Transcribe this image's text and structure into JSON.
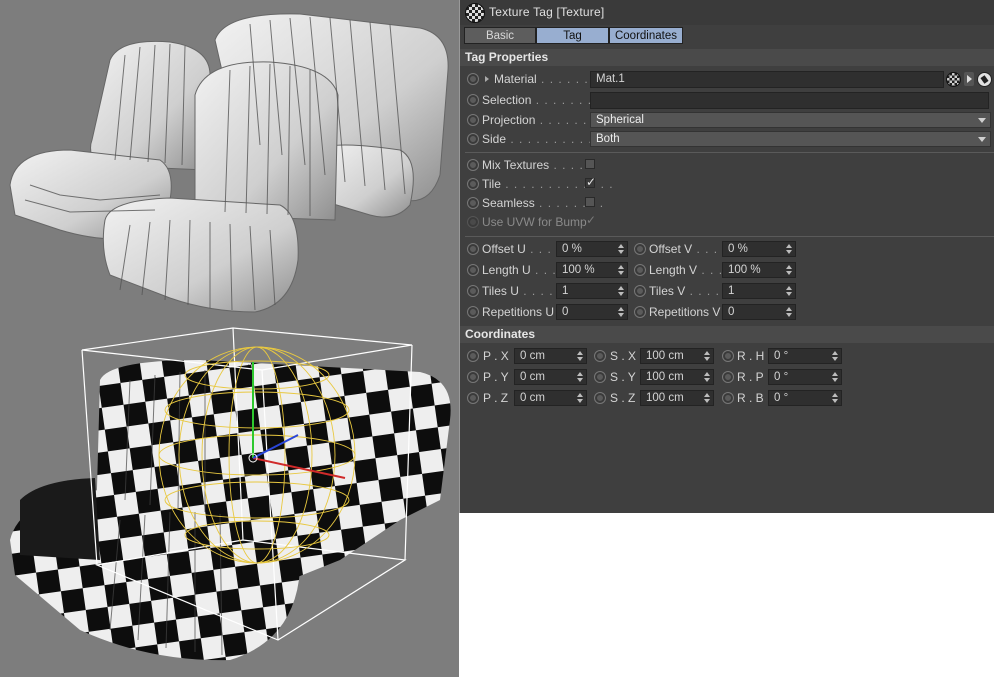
{
  "window": {
    "title": "Texture Tag [Texture]"
  },
  "tabs": [
    {
      "label": "Basic",
      "active": false
    },
    {
      "label": "Tag",
      "active": true
    },
    {
      "label": "Coordinates",
      "active": true
    }
  ],
  "tag_properties": {
    "heading": "Tag Properties",
    "material": {
      "label": "Material",
      "value": "Mat.1"
    },
    "selection": {
      "label": "Selection",
      "value": ""
    },
    "projection": {
      "label": "Projection",
      "value": "Spherical"
    },
    "side": {
      "label": "Side",
      "value": "Both"
    },
    "mix_textures": {
      "label": "Mix Textures",
      "checked": false
    },
    "tile": {
      "label": "Tile",
      "checked": true
    },
    "seamless": {
      "label": "Seamless",
      "checked": false
    },
    "use_uvw_for_bump": {
      "label": "Use UVW for Bump",
      "checked": true,
      "enabled": false
    },
    "offset_u": {
      "label": "Offset U",
      "value": "0 %"
    },
    "offset_v": {
      "label": "Offset V",
      "value": "0 %"
    },
    "length_u": {
      "label": "Length U",
      "value": "100 %"
    },
    "length_v": {
      "label": "Length V",
      "value": "100 %"
    },
    "tiles_u": {
      "label": "Tiles U",
      "value": "1"
    },
    "tiles_v": {
      "label": "Tiles V",
      "value": "1"
    },
    "repetitions_u": {
      "label": "Repetitions U",
      "value": "0"
    },
    "repetitions_v": {
      "label": "Repetitions V",
      "value": "0"
    }
  },
  "coordinates": {
    "heading": "Coordinates",
    "px": {
      "label": "P . X",
      "value": "0 cm"
    },
    "py": {
      "label": "P . Y",
      "value": "0 cm"
    },
    "pz": {
      "label": "P . Z",
      "value": "0 cm"
    },
    "sx": {
      "label": "S . X",
      "value": "100 cm"
    },
    "sy": {
      "label": "S . Y",
      "value": "100 cm"
    },
    "sz": {
      "label": "S . Z",
      "value": "100 cm"
    },
    "rh": {
      "label": "R . H",
      "value": "0 °"
    },
    "rp": {
      "label": "R . P",
      "value": "0 °"
    },
    "rb": {
      "label": "R . B",
      "value": "0 °"
    }
  },
  "icons": {
    "tag_icon": "checker-sphere-icon",
    "material_ball": "material-preview-icon",
    "material_menu": "triangle-right-icon",
    "material_pick": "pick-cursor-icon"
  },
  "colors": {
    "viewport_bg": "#7d7d7d",
    "panel_bg": "#3f3f3f",
    "tab_active": "#98aed0",
    "wireframe": "#e8c840"
  }
}
